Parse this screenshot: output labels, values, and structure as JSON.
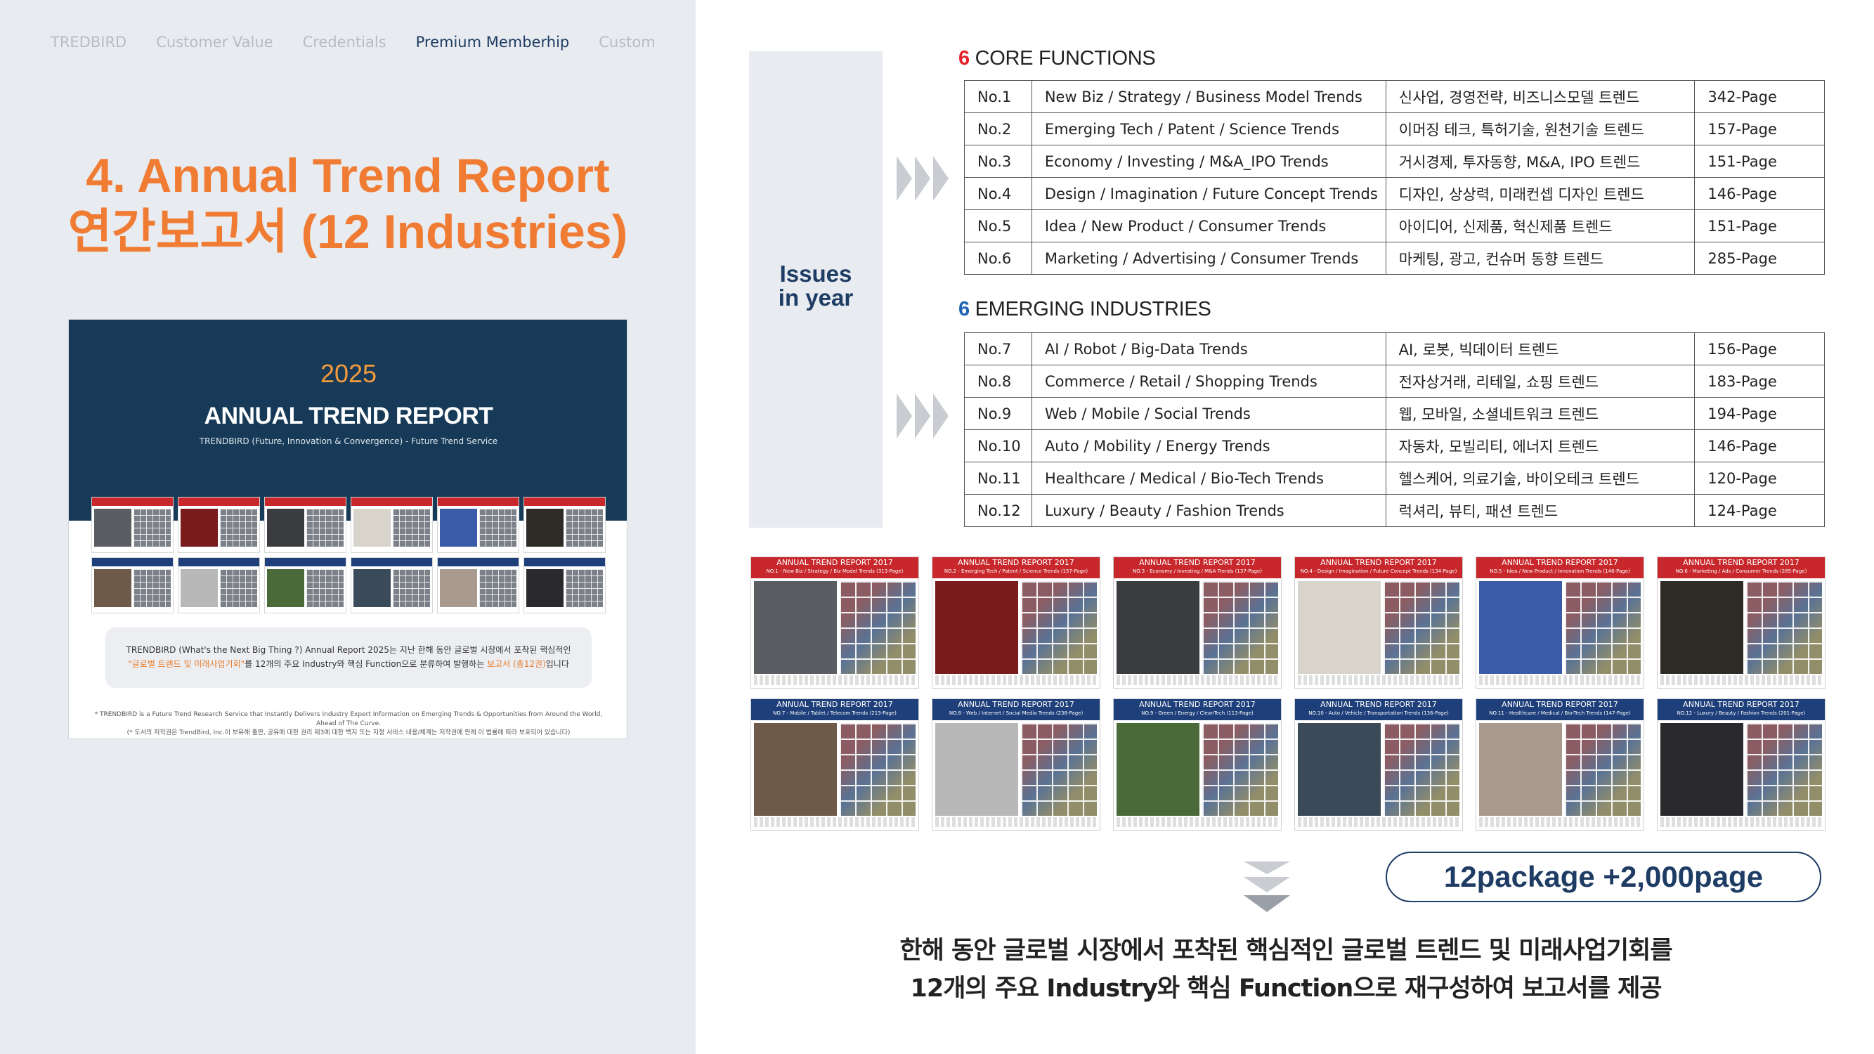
{
  "nav": {
    "items": [
      {
        "label": "TREDBIRD",
        "active": false
      },
      {
        "label": "Customer Value",
        "active": false
      },
      {
        "label": "Credentials",
        "active": false
      },
      {
        "label": "Premium Memberhip",
        "active": true
      },
      {
        "label": "Custom",
        "active": false
      }
    ]
  },
  "left": {
    "title_line1": "4. Annual Trend Report",
    "title_line2": "연간보고서 (12 Industries)"
  },
  "cover": {
    "year": "2025",
    "title": "ANNUAL TREND REPORT",
    "subtitle": "TRENDBIRD (Future, Innovation & Convergence) -  Future Trend Service",
    "box_line1": "TRENDBIRD (What's the Next Big Thing ?) Annual Report 2025는 지난 한해 동안 글로벌 시장에서 포착된 핵심적인",
    "box_line2_hl1": "\"글로벌 트렌드 및 미래사업기회\"",
    "box_line2_mid": "를 12개의 주요 Industry와 핵심 Function으로 분류하여 발행하는 ",
    "box_line2_hl2": "보고서 (총12권)",
    "box_line2_end": "입니다",
    "foot_line1": "* TRENDBIRD is a Future Trend Research Service that Instantly Delivers Industry Expert Information on Emerging Trends & Opportunities from Around the World, Ahead of The Curve.",
    "foot_line2": "(* 도서의 저작권은 TrendBird, Inc.이 보유해 출판, 공유에 대한 권리 제3에 대한 백지 또는 지정 서비스 내용/체계는 저작권에 판례 이 법률에 따라 보호되어 있습니다)"
  },
  "issues": {
    "line1": "Issues",
    "line2": "in year"
  },
  "core": {
    "count": "6",
    "title": "CORE FUNCTIONS",
    "rows": [
      {
        "no": "No.1",
        "en": "New Biz / Strategy / Business Model Trends",
        "ko": "신사업, 경영전략, 비즈니스모델 트렌드",
        "pages": "342-Page"
      },
      {
        "no": "No.2",
        "en": "Emerging Tech / Patent / Science Trends",
        "ko": "이머징 테크, 특허기술, 원천기술 트렌드",
        "pages": "157-Page"
      },
      {
        "no": "No.3",
        "en": "Economy / Investing / M&A_IPO  Trends",
        "ko": "거시경제, 투자동향, M&A, IPO 트렌드",
        "pages": "151-Page"
      },
      {
        "no": "No.4",
        "en": "Design / Imagination / Future Concept Trends",
        "ko": "디자인, 상상력, 미래컨셉 디자인 트렌드",
        "pages": "146-Page"
      },
      {
        "no": "No.5",
        "en": "Idea / New Product / Consumer Trends",
        "ko": "아이디어, 신제품, 혁신제품 트렌드",
        "pages": "151-Page"
      },
      {
        "no": "No.6",
        "en": "Marketing / Advertising / Consumer Trends",
        "ko": "마케팅, 광고, 컨슈머 동향 트렌드",
        "pages": "285-Page"
      }
    ]
  },
  "emerging": {
    "count": "6",
    "title": "EMERGING INDUSTRIES",
    "rows": [
      {
        "no": "No.7",
        "en": "AI / Robot / Big-Data Trends",
        "ko": "AI, 로봇, 빅데이터 트렌드",
        "pages": "156-Page"
      },
      {
        "no": "No.8",
        "en": "Commerce / Retail / Shopping Trends",
        "ko": "전자상거래, 리테일, 쇼핑 트렌드",
        "pages": "183-Page"
      },
      {
        "no": "No.9",
        "en": "Web / Mobile / Social Trends",
        "ko": "웹, 모바일, 소셜네트워크 트렌드",
        "pages": "194-Page"
      },
      {
        "no": "No.10",
        "en": "Auto / Mobility / Energy Trends",
        "ko": "자동차, 모빌리티, 에너지 트렌드",
        "pages": "146-Page"
      },
      {
        "no": "No.11",
        "en": "Healthcare / Medical / Bio-Tech Trends",
        "ko": "헬스케어, 의료기술, 바이오테크 트렌드",
        "pages": "120-Page"
      },
      {
        "no": "No.12",
        "en": "Luxury / Beauty / Fashion Trends",
        "ko": "럭셔리, 뷰티, 패션 트렌드",
        "pages": "124-Page"
      }
    ]
  },
  "reports": [
    {
      "title": "ANNUAL TREND REPORT 2017",
      "sub": "NO.1 - New Biz / Strategy / Biz Model Trends (313-Page)",
      "band": "red",
      "hero": "#5a5e62"
    },
    {
      "title": "ANNUAL TREND REPORT 2017",
      "sub": "NO.2 - Emerging Tech / Patent / Science Trends (157-Page)",
      "band": "red",
      "hero": "#7a1a1a"
    },
    {
      "title": "ANNUAL TREND REPORT 2017",
      "sub": "NO.3 - Economy / Investing / M&A Trends (137-Page)",
      "band": "red",
      "hero": "#3a3c40"
    },
    {
      "title": "ANNUAL TREND REPORT 2017",
      "sub": "NO.4 - Design / Imagination / Future Concept Trends (134-Page)",
      "band": "red",
      "hero": "#d8d4cc"
    },
    {
      "title": "ANNUAL TREND REPORT 2017",
      "sub": "NO.5 - Idea / New Product / Innovation Trends (146-Page)",
      "band": "red",
      "hero": "#3b5aa8"
    },
    {
      "title": "ANNUAL TREND REPORT 2017",
      "sub": "NO.6 - Marketing / Ads / Consumer Trends (285-Page)",
      "band": "red",
      "hero": "#2e2a26"
    },
    {
      "title": "ANNUAL TREND REPORT 2017",
      "sub": "NO.7 - Mobile / Tablet / Telecom Trends (213-Page)",
      "band": "blue",
      "hero": "#6e5a48"
    },
    {
      "title": "ANNUAL TREND REPORT 2017",
      "sub": "NO.8 - Web / Internet / Social Media Trends (238-Page)",
      "band": "blue",
      "hero": "#b8b8b8"
    },
    {
      "title": "ANNUAL TREND REPORT 2017",
      "sub": "NO.9 - Green / Energy / CleanTech (113-Page)",
      "band": "blue",
      "hero": "#4a6a3a"
    },
    {
      "title": "ANNUAL TREND REPORT 2017",
      "sub": "NO.10 - Auto / Vehicle / Transportation Trends (136-Page)",
      "band": "blue",
      "hero": "#3a4a58"
    },
    {
      "title": "ANNUAL TREND REPORT 2017",
      "sub": "NO.11 - Healthcare / Medical / Bio-Tech Trends (147-Page)",
      "band": "blue",
      "hero": "#a89a8e"
    },
    {
      "title": "ANNUAL TREND REPORT 2017",
      "sub": "NO.12 - Luxury / Beauty / Fashion Trends (201-Page)",
      "band": "blue",
      "hero": "#2a2a2c"
    }
  ],
  "package": "12package +2,000page",
  "bottom": {
    "line1": "한해 동안 글로벌 시장에서 포착된 핵심적인 글로벌 트렌드 및 미래사업기회를",
    "line2": "12개의 주요 Industry와 핵심 Function으로 재구성하여 보고서를 제공"
  },
  "colors": {
    "accent_orange": "#f07b33",
    "navy": "#1e3c64",
    "core_red": "#e2232a",
    "emerging_blue": "#1e64b4",
    "report_red": "#c8282c",
    "report_blue": "#1e3f7a"
  }
}
